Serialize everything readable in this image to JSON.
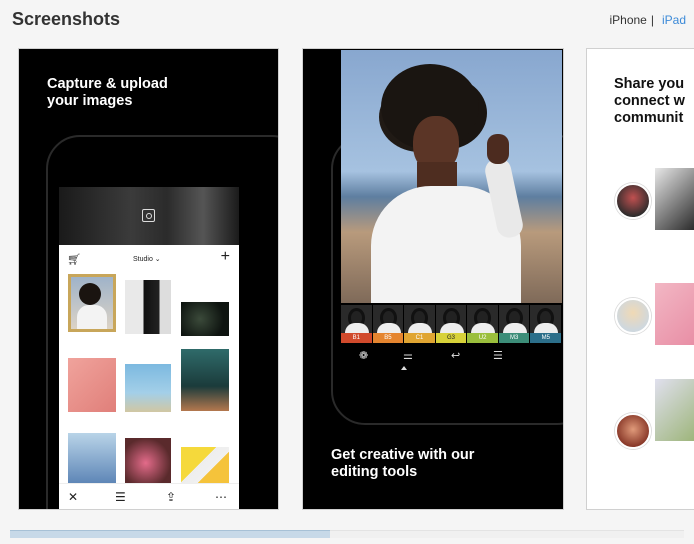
{
  "section": {
    "title": "Screenshots",
    "devices": [
      "iPhone",
      "iPad"
    ],
    "separator": "|",
    "selected_device": "iPhone"
  },
  "screenshots": [
    {
      "caption_line1": "Capture & upload",
      "caption_line2": "your images",
      "app": {
        "header_label": "Studio ⌄",
        "icons": [
          "cart-icon",
          "plus-icon",
          "close-icon",
          "adjust-icon",
          "upload-icon",
          "more-icon",
          "camera-icon"
        ]
      }
    },
    {
      "caption_line1": "Get creative with our",
      "caption_line2": "editing tools",
      "filters": [
        "B1",
        "B5",
        "C1",
        "G3",
        "U2",
        "M3",
        "M5"
      ],
      "icons": [
        "filter-icon",
        "sliders-icon",
        "undo-icon",
        "list-icon"
      ]
    },
    {
      "caption_line1": "Share you",
      "caption_line2": "connect w",
      "caption_line3": "communit"
    }
  ],
  "colors": {
    "link": "#3c8ad8",
    "filter_strip": [
      "#d14a2c",
      "#e5852f",
      "#e0a532",
      "#d8d23a",
      "#9bbf3d",
      "#3c8d78",
      "#2c6f8a"
    ]
  }
}
